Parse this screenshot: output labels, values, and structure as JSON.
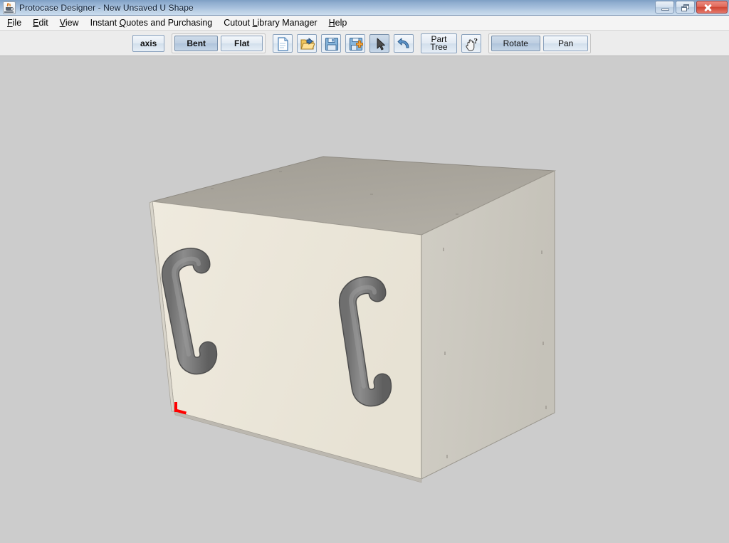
{
  "window": {
    "title": "Protocase Designer - New Unsaved U Shape",
    "app_icon": "java-coffee-cup-icon",
    "controls": [
      {
        "name": "minimize",
        "glyph": "minimize-icon",
        "label": "Minimize"
      },
      {
        "name": "restore",
        "glyph": "restore-icon",
        "label": "Restore"
      },
      {
        "name": "close",
        "glyph": "close-icon",
        "label": "Close"
      }
    ]
  },
  "menubar": {
    "items": [
      {
        "label": "File",
        "mnemonic": "F"
      },
      {
        "label": "Edit",
        "mnemonic": "E"
      },
      {
        "label": "View",
        "mnemonic": "V"
      },
      {
        "label": "Instant Quotes and Purchasing",
        "mnemonic": "Q"
      },
      {
        "label": "Cutout Library Manager",
        "mnemonic": "L"
      },
      {
        "label": "Help",
        "mnemonic": "H"
      }
    ]
  },
  "toolbar": {
    "axis_button": {
      "label": "axis",
      "selected": false
    },
    "view_mode_group": [
      {
        "label": "Bent",
        "selected": true
      },
      {
        "label": "Flat",
        "selected": false
      }
    ],
    "file_icons": [
      {
        "name": "new-document-icon",
        "tooltip": "New"
      },
      {
        "name": "open-folder-icon",
        "tooltip": "Open"
      },
      {
        "name": "save-icon",
        "tooltip": "Save"
      },
      {
        "name": "save-as-icon",
        "tooltip": "Save As"
      },
      {
        "name": "select-arrow-icon",
        "tooltip": "Select",
        "pressed": true
      },
      {
        "name": "undo-icon",
        "tooltip": "Undo"
      }
    ],
    "part_tree_button": {
      "line1": "Part",
      "line2": "Tree"
    },
    "help_cursor_icon": {
      "name": "whats-this-help-icon",
      "tooltip": "What's This?"
    },
    "navigation_group": [
      {
        "label": "Rotate",
        "selected": true
      },
      {
        "label": "Pan",
        "selected": false
      }
    ]
  },
  "viewport": {
    "background_color": "#cccccc",
    "model": {
      "name": "U Shape enclosure",
      "face_front_color": "#ecE7DA",
      "face_top_color": "#a8a49c",
      "face_right_color": "#cbc8bf",
      "edge_color": "#9a968d",
      "handle_color": "#808080",
      "handle_count": 2,
      "origin_marker_color": "#ff0000"
    }
  },
  "colors": {
    "titlebar_top": "#7e9fc4",
    "titlebar_bottom": "#cadcee",
    "toolbar_bg": "#ececec",
    "menubar_bg": "#f4f4f4",
    "viewport_bg": "#cccccc",
    "accent_selected": "#bdcee1",
    "close_button": "#cf4533"
  }
}
